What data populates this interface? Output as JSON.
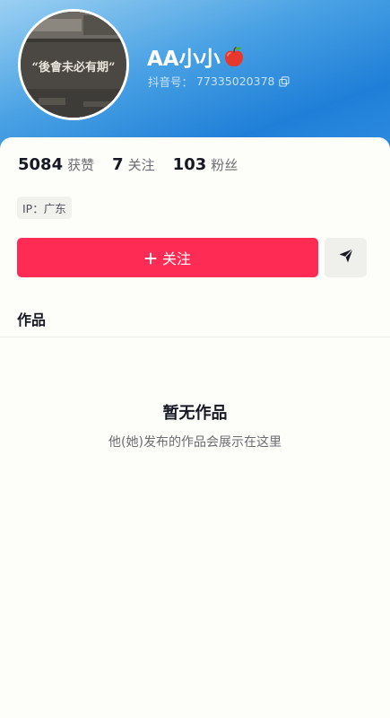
{
  "profile": {
    "nickname": "AA小小",
    "nickname_emoji_icon": "red-apple-icon",
    "uid_label": "抖音号：",
    "uid_value": "77335020378",
    "avatar_text": "“後會未必有期”"
  },
  "stats": [
    {
      "value": "5084",
      "label": "获赞"
    },
    {
      "value": "7",
      "label": "关注"
    },
    {
      "value": "103",
      "label": "粉丝"
    }
  ],
  "ip_tag": "IP：广东",
  "actions": {
    "follow_label": "关注",
    "follow_icon": "plus-icon",
    "share_icon": "send-arrow-icon"
  },
  "tabs": [
    {
      "label": "作品"
    }
  ],
  "empty_state": {
    "title": "暂无作品",
    "description": "他(她)发布的作品会展示在这里"
  },
  "colors": {
    "primary_button": "#fe2c55",
    "banner_blue": "#1f7fd8",
    "background": "#fdfdf9"
  }
}
